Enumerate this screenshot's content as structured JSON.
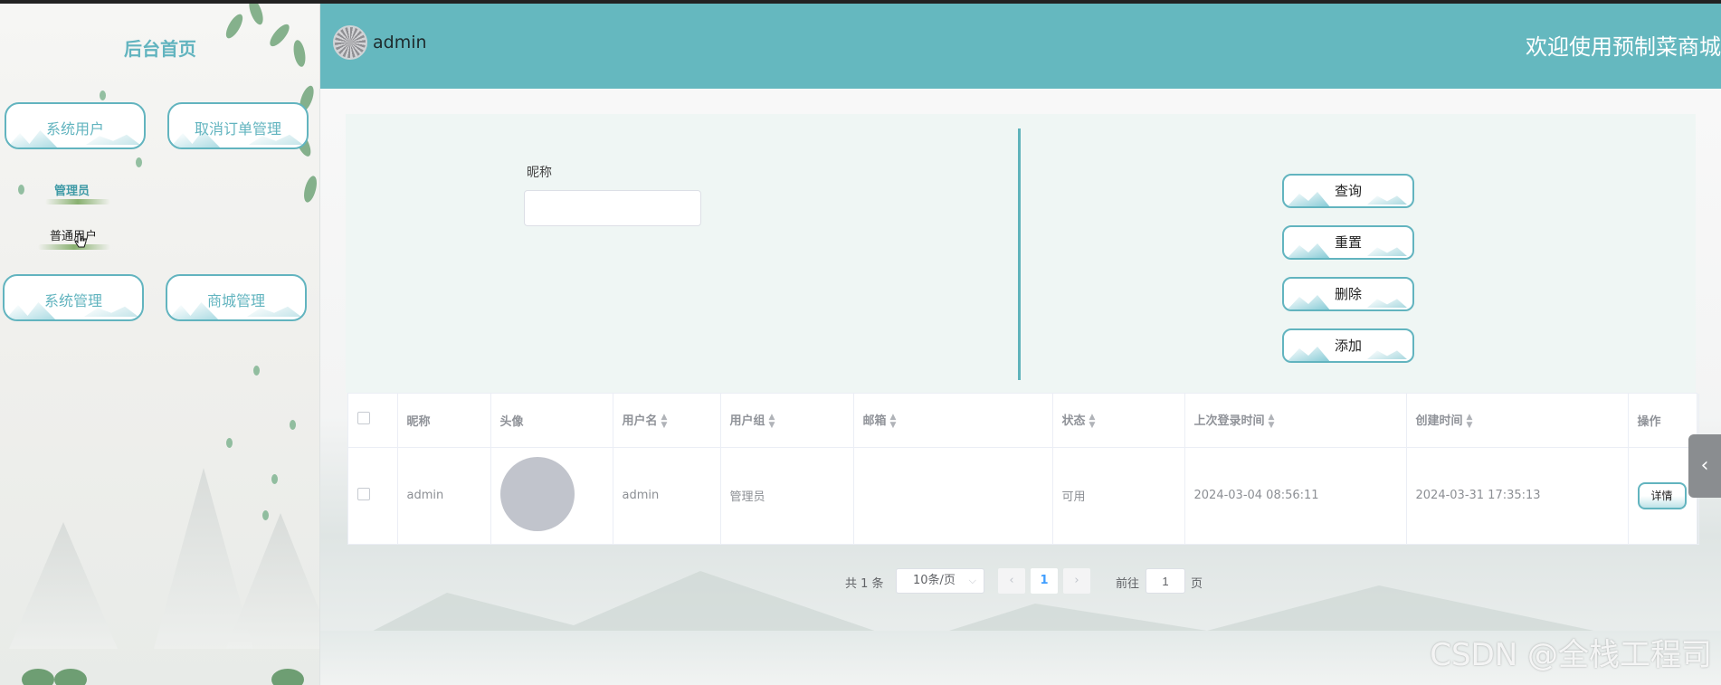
{
  "sidebar": {
    "title": "后台首页",
    "menu": [
      {
        "label": "系统用户"
      },
      {
        "label": "取消订单管理"
      },
      {
        "label": "系统管理"
      },
      {
        "label": "商城管理"
      }
    ],
    "submenu": {
      "admin": "管理员",
      "user": "普通用户"
    }
  },
  "header": {
    "username": "admin",
    "welcome": "欢迎使用预制菜商城"
  },
  "search": {
    "nickname_label": "昵称",
    "nickname_value": "",
    "buttons": {
      "query": "查询",
      "reset": "重置",
      "delete": "删除",
      "add": "添加"
    }
  },
  "table": {
    "columns": {
      "nickname": "昵称",
      "avatar": "头像",
      "username": "用户名",
      "group": "用户组",
      "email": "邮箱",
      "status": "状态",
      "last_login": "上次登录时间",
      "created": "创建时间",
      "actions": "操作"
    },
    "rows": [
      {
        "nickname": "admin",
        "username": "admin",
        "group": "管理员",
        "email": "",
        "status": "可用",
        "last_login": "2024-03-04 08:56:11",
        "created": "2024-03-31 17:35:13",
        "detail_label": "详情"
      }
    ]
  },
  "pagination": {
    "total": "共 1 条",
    "page_size": "10条/页",
    "current_page": "1",
    "goto_label": "前往",
    "goto_value": "1",
    "page_suffix": "页"
  },
  "watermark": "CSDN @全栈工程司",
  "colors": {
    "accent": "#65b8bf",
    "panel": "#eff6f4"
  }
}
